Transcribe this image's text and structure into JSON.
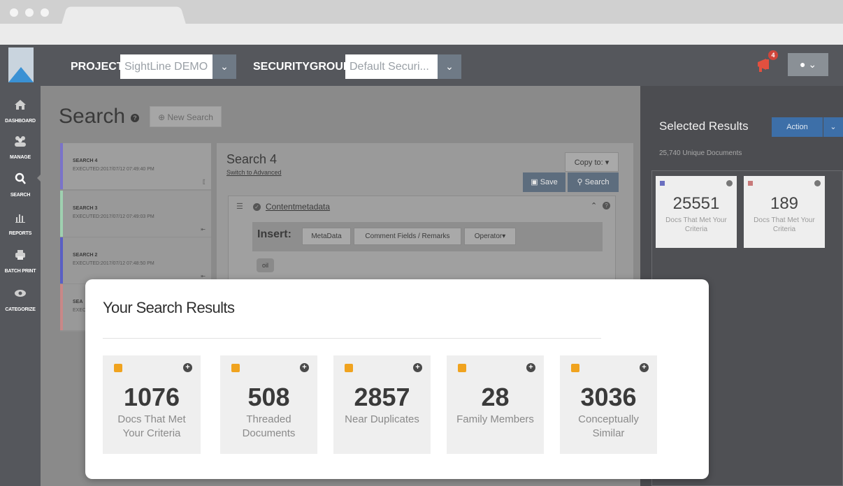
{
  "header": {
    "project_label": "PROJECT:",
    "project_value": "SightLine DEMO",
    "securitygroup_label": "SECURITYGROUP:",
    "securitygroup_value": "Default Securi...",
    "notification_count": "4"
  },
  "nav": {
    "items": [
      {
        "label": "DASHBOARD",
        "icon": "home-icon"
      },
      {
        "label": "MANAGE",
        "icon": "users-icon"
      },
      {
        "label": "SEARCH",
        "icon": "search-icon"
      },
      {
        "label": "REPORTS",
        "icon": "chart-icon"
      },
      {
        "label": "BATCH PRINT",
        "icon": "printer-icon"
      },
      {
        "label": "CATEGORIZE",
        "icon": "eye-icon"
      }
    ]
  },
  "page": {
    "title": "Search",
    "new_search_label": "New Search"
  },
  "searches": [
    {
      "title": "SEARCH 4",
      "executed": "EXECUTED:2017/07/12 07:49:40 PM",
      "color": "#7a73c9"
    },
    {
      "title": "SEARCH 3",
      "executed": "EXECUTED:2017/07/12 07:49:03 PM",
      "color": "#9fd1b0"
    },
    {
      "title": "SEARCH 2",
      "executed": "EXECUTED:2017/07/12 07:48:50 PM",
      "color": "#5a5fc4"
    },
    {
      "title": "SEA",
      "executed": "EXEC",
      "color": "#c98787"
    }
  ],
  "panel": {
    "title": "Search 4",
    "switch_link": "Switch to Advanced",
    "copy_to": "Copy to: ▾",
    "save": "Save",
    "search": "Search",
    "field": "Contentmetadata",
    "insert_label": "Insert:",
    "insert_buttons": [
      "MetaData",
      "Comment Fields / Remarks",
      "Operator▾"
    ],
    "chip": "oil"
  },
  "selected": {
    "title": "Selected Results",
    "action": "Action",
    "unique_docs": "25,740 Unique Documents",
    "cards": [
      {
        "value": "25551",
        "label": "Docs That Met Your Criteria",
        "color": "#6a6fc0"
      },
      {
        "value": "189",
        "label": "Docs That Met Your Criteria",
        "color": "#c87a7a"
      }
    ]
  },
  "results": {
    "title": "Your Search Results",
    "cards": [
      {
        "value": "1076",
        "label": "Docs That Met Your Criteria"
      },
      {
        "value": "508",
        "label": "Threaded Documents"
      },
      {
        "value": "2857",
        "label": "Near Duplicates"
      },
      {
        "value": "28",
        "label": "Family Members"
      },
      {
        "value": "3036",
        "label": "Conceptually Similar"
      }
    ]
  }
}
